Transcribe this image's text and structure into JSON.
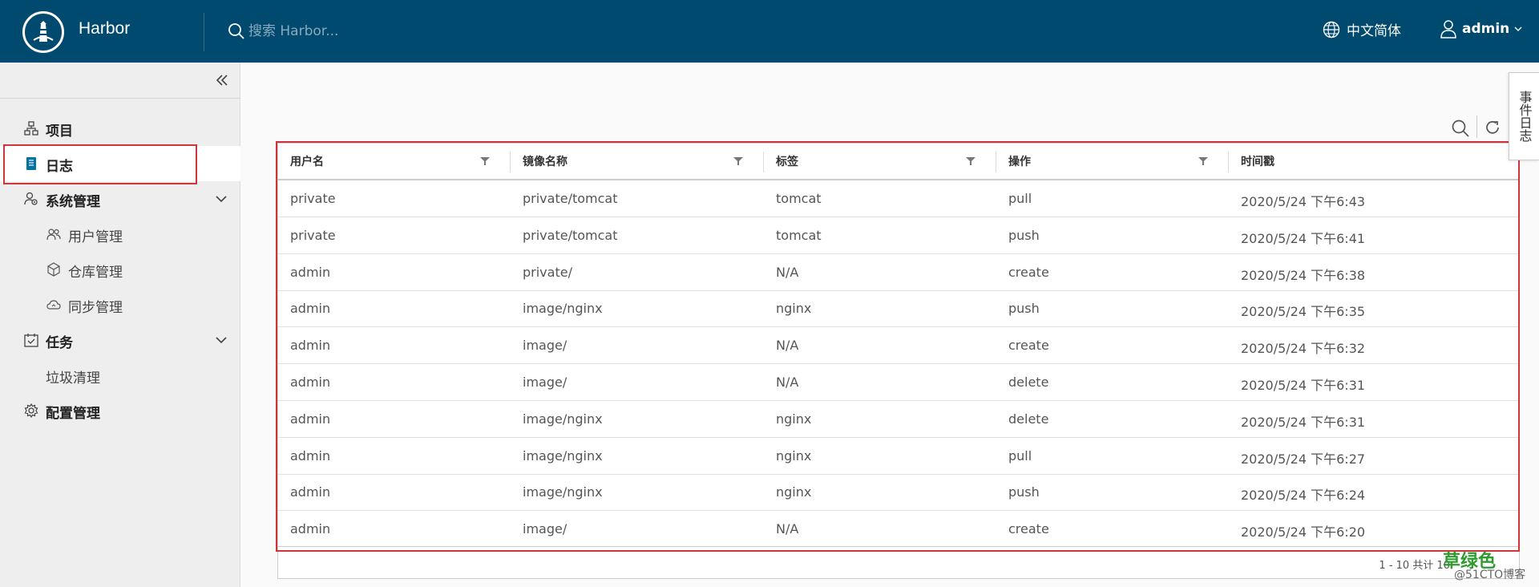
{
  "header": {
    "brand": "Harbor",
    "search_placeholder": "搜索 Harbor...",
    "language": "中文简体",
    "user": "admin"
  },
  "sidebar": {
    "items": [
      {
        "label": "项目",
        "icon": "project-icon"
      },
      {
        "label": "日志",
        "icon": "log-icon"
      },
      {
        "label": "系统管理",
        "icon": "system-admin-icon"
      },
      {
        "label": "用户管理",
        "icon": "users-icon"
      },
      {
        "label": "仓库管理",
        "icon": "box-icon"
      },
      {
        "label": "同步管理",
        "icon": "cloud-sync-icon"
      },
      {
        "label": "任务",
        "icon": "task-icon"
      },
      {
        "label": "垃圾清理",
        "icon": ""
      },
      {
        "label": "配置管理",
        "icon": "gear-icon"
      }
    ]
  },
  "event_tab": "事件日志",
  "table": {
    "columns": [
      "用户名",
      "镜像名称",
      "标签",
      "操作",
      "时间戳"
    ],
    "rows": [
      [
        "private",
        "private/tomcat",
        "tomcat",
        "pull",
        "2020/5/24 下午6:43"
      ],
      [
        "private",
        "private/tomcat",
        "tomcat",
        "push",
        "2020/5/24 下午6:41"
      ],
      [
        "admin",
        "private/",
        "N/A",
        "create",
        "2020/5/24 下午6:38"
      ],
      [
        "admin",
        "image/nginx",
        "nginx",
        "push",
        "2020/5/24 下午6:35"
      ],
      [
        "admin",
        "image/",
        "N/A",
        "create",
        "2020/5/24 下午6:32"
      ],
      [
        "admin",
        "image/",
        "N/A",
        "delete",
        "2020/5/24 下午6:31"
      ],
      [
        "admin",
        "image/nginx",
        "nginx",
        "delete",
        "2020/5/24 下午6:31"
      ],
      [
        "admin",
        "image/nginx",
        "nginx",
        "pull",
        "2020/5/24 下午6:27"
      ],
      [
        "admin",
        "image/nginx",
        "nginx",
        "push",
        "2020/5/24 下午6:24"
      ],
      [
        "admin",
        "image/",
        "N/A",
        "create",
        "2020/5/24 下午6:20"
      ]
    ]
  },
  "pagination": "1 - 10 共计 10",
  "watermark": {
    "line1": "草绿色",
    "line2": "@51CTO博客"
  },
  "colors": {
    "header": "#004a70",
    "highlight": "#d0343b"
  }
}
